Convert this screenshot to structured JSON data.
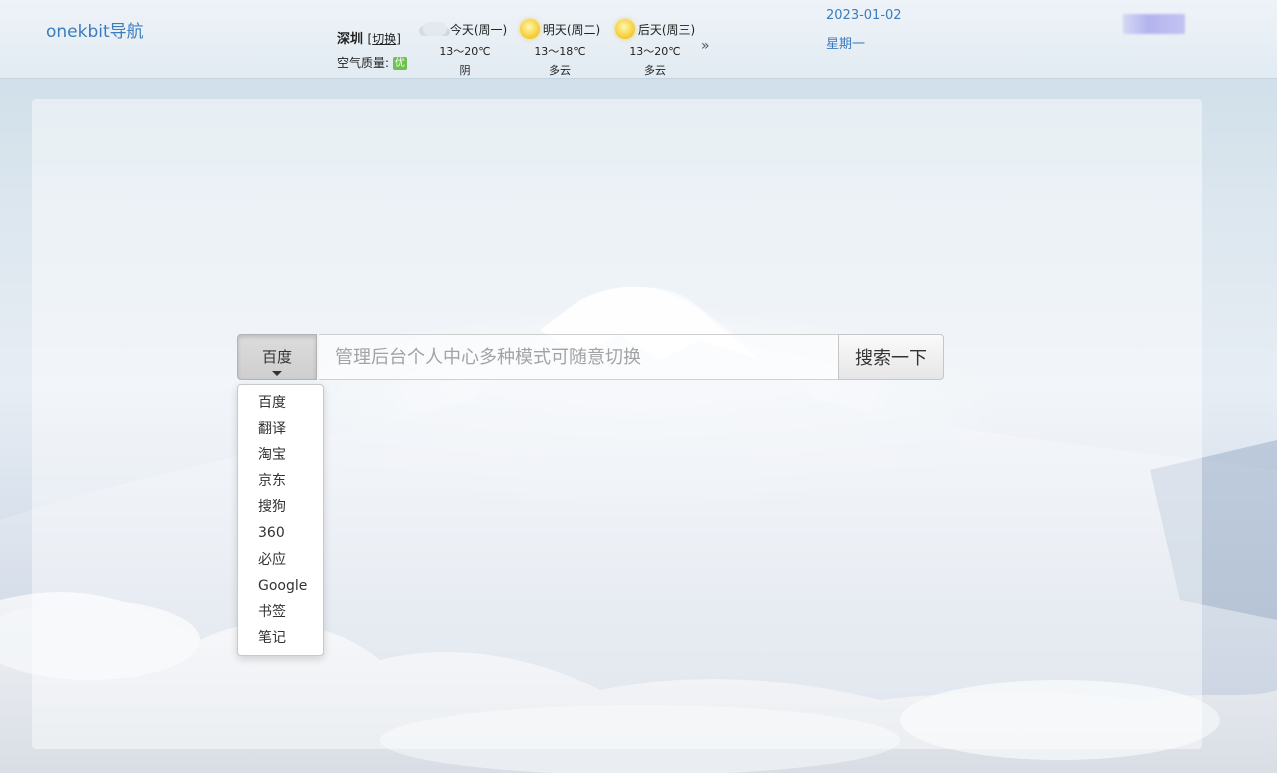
{
  "header": {
    "logo": "onekbit导航",
    "date": "2023-01-02",
    "weekday": "星期一"
  },
  "weather": {
    "city": "深圳",
    "switch_label": "切换",
    "air_quality_label": "空气质量:",
    "air_quality_value": "优",
    "more_icon": "»",
    "days": [
      {
        "label": "今天(周一)",
        "icon": "cloud-icon",
        "temp": "13～20℃",
        "condition": "阴"
      },
      {
        "label": "明天(周二)",
        "icon": "sun-icon",
        "temp": "13～18℃",
        "condition": "多云"
      },
      {
        "label": "后天(周三)",
        "icon": "sun-icon",
        "temp": "13～20℃",
        "condition": "多云"
      }
    ]
  },
  "search": {
    "engine_selected": "百度",
    "placeholder": "管理后台个人中心多种模式可随意切换",
    "button_label": "搜索一下",
    "engines": [
      "百度",
      "翻译",
      "淘宝",
      "京东",
      "搜狗",
      "360",
      "必应",
      "Google",
      "书签",
      "笔记"
    ]
  },
  "colors": {
    "link": "#3a7cbd",
    "aq_good": "#6cc24a"
  }
}
